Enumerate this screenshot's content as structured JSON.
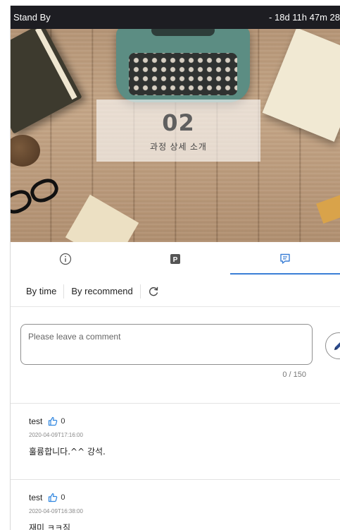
{
  "statusbar": {
    "left": "Stand By",
    "right": "- 18d 11h 47m 28"
  },
  "hero": {
    "number": "02",
    "subtitle": "과정 상세 소개"
  },
  "tabs": [
    {
      "icon": "info-icon",
      "active": false
    },
    {
      "icon": "p-badge-icon",
      "label": "P",
      "active": false
    },
    {
      "icon": "comment-icon",
      "active": true
    }
  ],
  "sort": {
    "by_time": "By time",
    "by_recommend": "By recommend",
    "refresh_icon": "refresh-icon"
  },
  "comment_box": {
    "placeholder": "Please leave a comment",
    "counter": "0 / 150",
    "submit_icon": "pencil-icon"
  },
  "comments": [
    {
      "author": "test",
      "likes": "0",
      "time": "2020-04-09T17:16:00",
      "text": "훌륭합니다.^^ 강석."
    },
    {
      "author": "test",
      "likes": "0",
      "time": "2020-04-09T16:38:00",
      "text": "재미 ㅋㅋ짐"
    }
  ],
  "colors": {
    "accent": "#3b7fd6",
    "statusbar_bg": "#1d1d22",
    "like": "#2f86e0"
  }
}
